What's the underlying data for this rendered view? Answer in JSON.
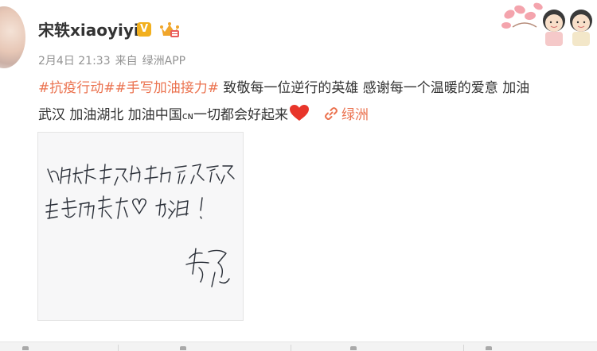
{
  "user": {
    "name": "宋轶xiaoyiyi",
    "vip_badge": "V",
    "avatar_icon": "user-avatar"
  },
  "meta": {
    "date": "2月4日 21:33",
    "source_prefix": "来自",
    "source_app": "绿洲APP"
  },
  "post": {
    "hashtag_1": "#抗疫行动#",
    "hashtag_2": "#手写加油接力#",
    "line1_text": " 致敬每一位逆行的英雄 感谢每一个温暖的爱意 加油",
    "line2_text": "武汉 加油湖北 加油中国",
    "cn_mark": "ᴄɴ",
    "line2_text_b": "一切都会好起来",
    "heart_icon": "red-heart-emoji",
    "link_icon": "link-icon",
    "link_label": "绿洲"
  },
  "image": {
    "type": "handwritten-note",
    "icon": "handwriting-photo"
  },
  "colors": {
    "accent": "#eb7350",
    "text": "#333333",
    "meta": "#939393",
    "vip": "#f2b01e",
    "heart": "#e8352a"
  }
}
